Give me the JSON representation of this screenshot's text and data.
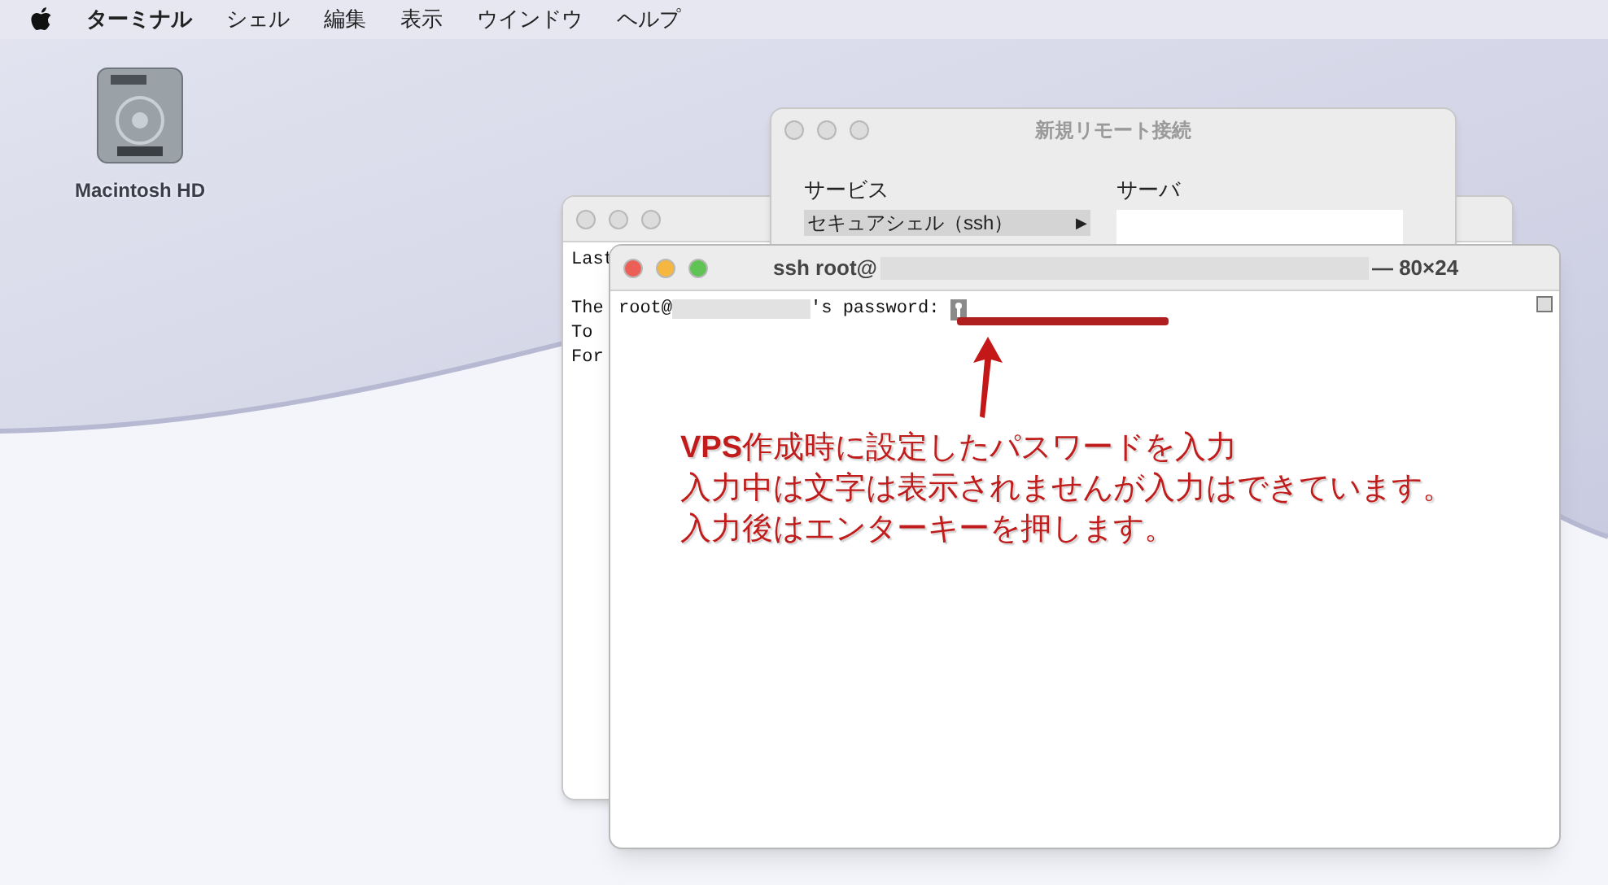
{
  "menu_bar": {
    "app_name": "ターミナル",
    "items": [
      "シェル",
      "編集",
      "表示",
      "ウインドウ",
      "ヘルプ"
    ]
  },
  "desktop_icons": [
    {
      "label": "Macintosh HD"
    }
  ],
  "remote_window": {
    "title": "新規リモート接続",
    "columns": [
      "サービス",
      "サーバ"
    ],
    "services": [
      {
        "label": "セキュアシェル（ssh）",
        "selected": true,
        "arrow": "▶"
      }
    ]
  },
  "back_terminal": {
    "lines": [
      "Last",
      "The",
      "To",
      "For"
    ]
  },
  "front_terminal": {
    "title_prefix": "ssh root@",
    "title_suffix": "— 80×24",
    "prompt_prefix": "root@",
    "prompt_suffix": "'s password:"
  },
  "annotation": {
    "lines": [
      "**VPS**作成時に設定したパスワードを入力",
      "入力中は文字は表示されませんが入力はできています。",
      "入力後はエンターキーを押します。"
    ]
  }
}
